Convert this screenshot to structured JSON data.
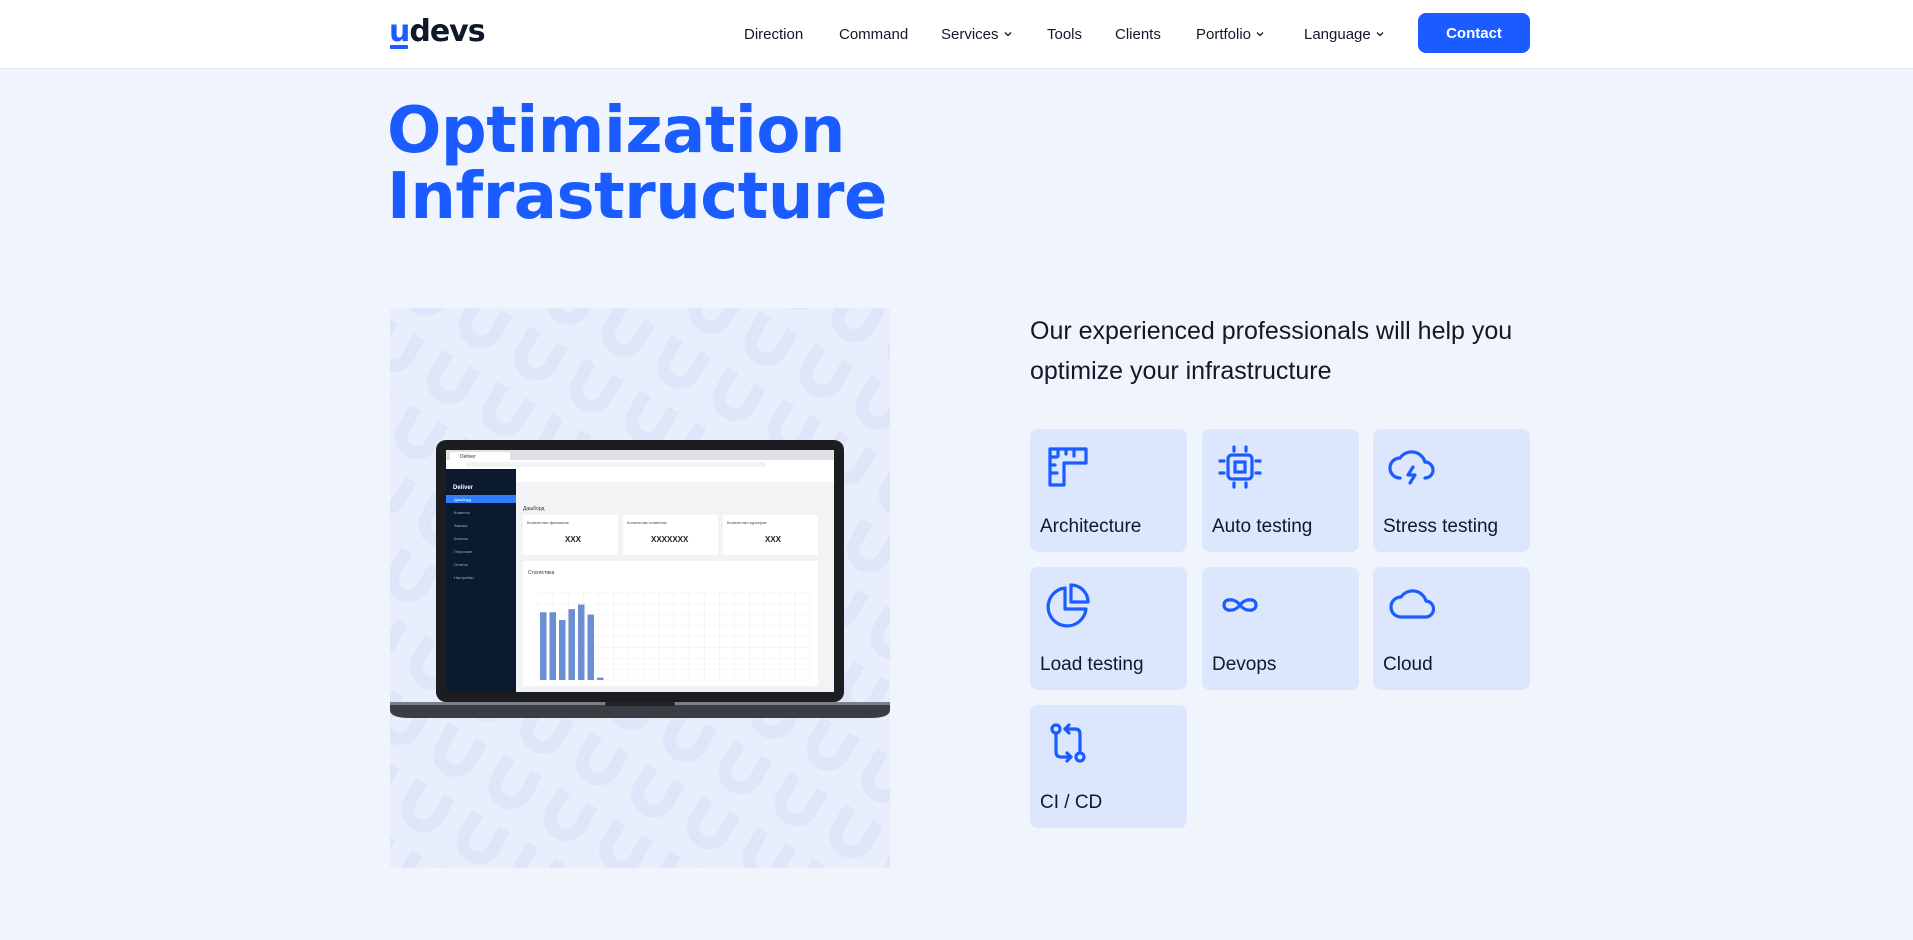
{
  "brand": {
    "logo_first": "u",
    "logo_rest": "devs",
    "accent": "#1a5cff",
    "background": "#f0f4fd",
    "card_bg": "#dce6fc"
  },
  "nav": {
    "items": [
      {
        "label": "Direction",
        "dropdown": false
      },
      {
        "label": "Command",
        "dropdown": false
      },
      {
        "label": "Services",
        "dropdown": true
      },
      {
        "label": "Tools",
        "dropdown": false
      },
      {
        "label": "Clients",
        "dropdown": false
      },
      {
        "label": "Portfolio",
        "dropdown": true
      },
      {
        "label": "Language",
        "dropdown": true
      }
    ],
    "contact_label": "Contact"
  },
  "hero": {
    "title_line1": "Optimization",
    "title_line2": "Infrastructure"
  },
  "main": {
    "lede": "Our experienced professionals will help you optimize your infrastructure"
  },
  "laptop": {
    "browser_tab": "Deliver",
    "app_name": "Deliver",
    "sidebar_active": "Дашборд",
    "sidebar_items": [
      "Дашборд",
      "Клиенты",
      "Заказы",
      "Каталог",
      "Персонал",
      "Отчеты",
      "Настройки"
    ],
    "page_heading": "Дашборд",
    "stats": [
      {
        "label": "Количество филиалов",
        "value": "XXX"
      },
      {
        "label": "Количество клиентов",
        "value": "XXXXXXX"
      },
      {
        "label": "Количество курьеров",
        "value": "XXX"
      }
    ],
    "chart_title": "Статистика",
    "bars": [
      0.88,
      0.88,
      0.78,
      0.92,
      0.98,
      0.85,
      0.03
    ]
  },
  "services": [
    {
      "label": "Architecture",
      "icon": "ruler-icon"
    },
    {
      "label": "Auto testing",
      "icon": "chip-icon"
    },
    {
      "label": "Stress testing",
      "icon": "cloud-lightning-icon"
    },
    {
      "label": "Load testing",
      "icon": "pie-chart-icon"
    },
    {
      "label": "Devops",
      "icon": "infinity-icon"
    },
    {
      "label": "Cloud",
      "icon": "cloud-icon"
    },
    {
      "label": "CI / CD",
      "icon": "git-compare-icon"
    }
  ]
}
